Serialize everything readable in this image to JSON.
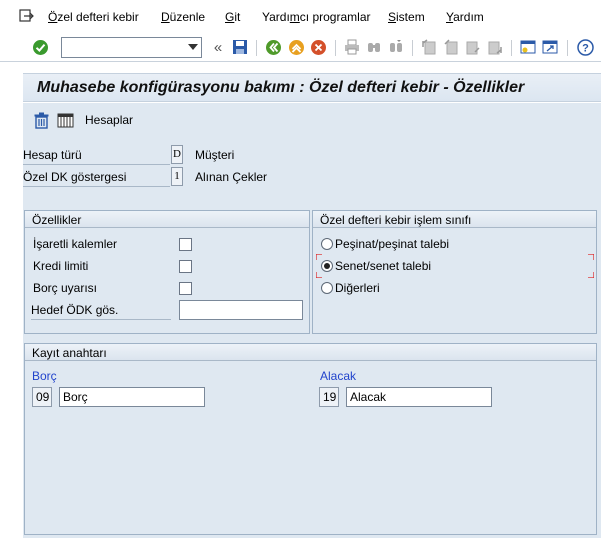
{
  "menu": {
    "items": [
      {
        "label": "Özel defteri kebir",
        "underline": "Ö"
      },
      {
        "label": "Düzenle",
        "underline": "D"
      },
      {
        "label": "Git",
        "underline": "G"
      },
      {
        "label": "Yardımcı programlar",
        "underline": "m"
      },
      {
        "label": "Sistem",
        "underline": "S"
      },
      {
        "label": "Yardım",
        "underline": "Y"
      }
    ]
  },
  "toolbar": {
    "command_value": "",
    "icons": [
      "enter-icon",
      "save-icon",
      "back-icon",
      "exit-icon",
      "cancel-icon",
      "print-icon",
      "find-icon",
      "find-next-icon",
      "first-page-icon",
      "previous-page-icon",
      "next-page-icon",
      "last-page-icon",
      "create-session-icon",
      "shortcut-icon",
      "help-icon"
    ],
    "colors": {
      "enter": "#3a9a2e",
      "back": "#4f9a2a",
      "exit": "#e8a020",
      "cancel": "#d4502a",
      "save": "#2b5aa8"
    }
  },
  "header": {
    "title": "Muhasebe konfigürasyonu bakımı : Özel defteri kebir - Özellikler"
  },
  "app_toolbar": {
    "accounts_label": "Hesaplar"
  },
  "fields": {
    "account_type": {
      "label": "Hesap türü",
      "code": "D",
      "value": "Müşteri"
    },
    "special_gl_indicator": {
      "label": "Özel DK göstergesi",
      "code": "1",
      "value": "Alınan Çekler"
    }
  },
  "properties": {
    "title": "Özellikler",
    "noted_items": {
      "label": "İşaretli kalemler",
      "checked": false
    },
    "credit_limit": {
      "label": "Kredi limiti",
      "checked": false
    },
    "commitment_warning": {
      "label": "Borç uyarısı",
      "checked": false
    },
    "target_sgl": {
      "label": "Hedef ÖDK gös.",
      "value": ""
    }
  },
  "transaction_class": {
    "title": "Özel defteri kebir işlem sınıfı",
    "options": [
      {
        "label": "Peşinat/peşinat talebi",
        "selected": false
      },
      {
        "label": "Senet/senet talebi",
        "selected": true
      },
      {
        "label": "Diğerleri",
        "selected": false
      }
    ]
  },
  "posting_key": {
    "title": "Kayıt anahtarı",
    "debit": {
      "label": "Borç",
      "code": "09",
      "name": "Borç"
    },
    "credit": {
      "label": "Alacak",
      "code": "19",
      "name": "Alacak"
    }
  }
}
